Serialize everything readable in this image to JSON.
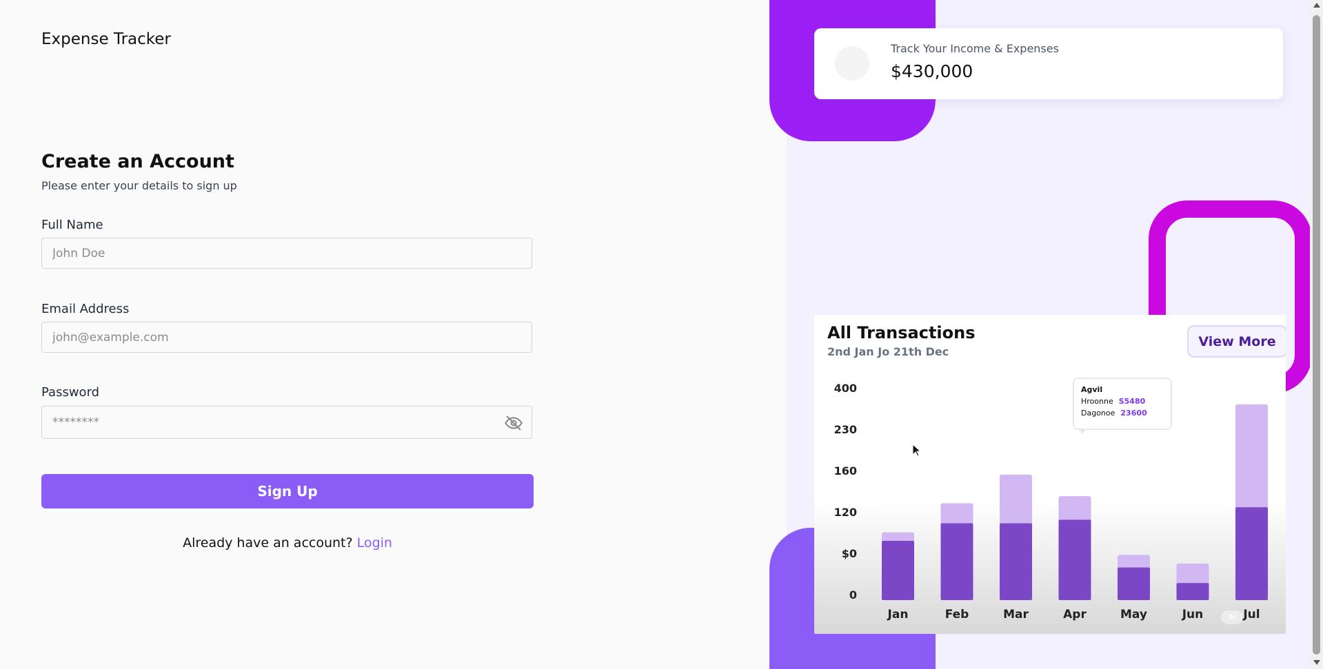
{
  "app": {
    "title": "Expense Tracker"
  },
  "signup": {
    "heading": "Create an Account",
    "subheading": "Please enter your details to sign up",
    "full_name": {
      "label": "Full Name",
      "placeholder": "John Doe",
      "value": ""
    },
    "email": {
      "label": "Email Address",
      "placeholder": "john@example.com",
      "value": ""
    },
    "password": {
      "label": "Password",
      "placeholder": "********",
      "value": "",
      "toggle_icon": "eye-off-icon"
    },
    "submit_label": "Sign Up",
    "login_prompt": "Already have an account?",
    "login_link": "Login"
  },
  "summary_card": {
    "label": "Track Your Income & Expenses",
    "value": "$430,000",
    "icon": "wallet-icon"
  },
  "transactions": {
    "title": "All Transactions",
    "subtitle": "2nd Jan Jo 21th Dec",
    "view_more_label": "View More",
    "tooltip": {
      "title": "Agvil",
      "rows": [
        {
          "label": "Hroonne",
          "value": "S5480"
        },
        {
          "label": "Dagonoe",
          "value": "23600"
        }
      ]
    },
    "watermark": "ai"
  },
  "colors": {
    "accent": "#8b5cf6",
    "deco_top": "#9c1ff5",
    "deco_ring": "#c909e0",
    "bar_dark": "#7c47c7",
    "bar_light": "#d1b8f2"
  },
  "chart_data": {
    "type": "bar",
    "categories": [
      "Jan",
      "Feb",
      "Mar",
      "Apr",
      "May",
      "Jun",
      "Jul"
    ],
    "y_ticks": [
      "400",
      "230",
      "160",
      "120",
      "$0",
      "0"
    ],
    "series": [
      {
        "values": [
          118,
          153,
          153,
          160,
          65,
          34,
          185
        ]
      },
      {
        "values": [
          135,
          193,
          250,
          207,
          90,
          73,
          390
        ]
      }
    ],
    "ylim": [
      0,
      420
    ]
  }
}
